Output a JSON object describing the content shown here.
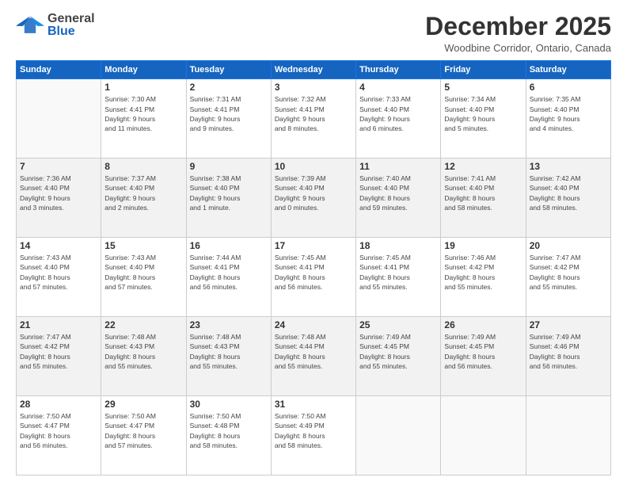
{
  "header": {
    "logo_general": "General",
    "logo_blue": "Blue",
    "month_title": "December 2025",
    "location": "Woodbine Corridor, Ontario, Canada"
  },
  "days_of_week": [
    "Sunday",
    "Monday",
    "Tuesday",
    "Wednesday",
    "Thursday",
    "Friday",
    "Saturday"
  ],
  "weeks": [
    [
      {
        "day": "",
        "info": ""
      },
      {
        "day": "1",
        "info": "Sunrise: 7:30 AM\nSunset: 4:41 PM\nDaylight: 9 hours\nand 11 minutes."
      },
      {
        "day": "2",
        "info": "Sunrise: 7:31 AM\nSunset: 4:41 PM\nDaylight: 9 hours\nand 9 minutes."
      },
      {
        "day": "3",
        "info": "Sunrise: 7:32 AM\nSunset: 4:41 PM\nDaylight: 9 hours\nand 8 minutes."
      },
      {
        "day": "4",
        "info": "Sunrise: 7:33 AM\nSunset: 4:40 PM\nDaylight: 9 hours\nand 6 minutes."
      },
      {
        "day": "5",
        "info": "Sunrise: 7:34 AM\nSunset: 4:40 PM\nDaylight: 9 hours\nand 5 minutes."
      },
      {
        "day": "6",
        "info": "Sunrise: 7:35 AM\nSunset: 4:40 PM\nDaylight: 9 hours\nand 4 minutes."
      }
    ],
    [
      {
        "day": "7",
        "info": "Sunrise: 7:36 AM\nSunset: 4:40 PM\nDaylight: 9 hours\nand 3 minutes."
      },
      {
        "day": "8",
        "info": "Sunrise: 7:37 AM\nSunset: 4:40 PM\nDaylight: 9 hours\nand 2 minutes."
      },
      {
        "day": "9",
        "info": "Sunrise: 7:38 AM\nSunset: 4:40 PM\nDaylight: 9 hours\nand 1 minute."
      },
      {
        "day": "10",
        "info": "Sunrise: 7:39 AM\nSunset: 4:40 PM\nDaylight: 9 hours\nand 0 minutes."
      },
      {
        "day": "11",
        "info": "Sunrise: 7:40 AM\nSunset: 4:40 PM\nDaylight: 8 hours\nand 59 minutes."
      },
      {
        "day": "12",
        "info": "Sunrise: 7:41 AM\nSunset: 4:40 PM\nDaylight: 8 hours\nand 58 minutes."
      },
      {
        "day": "13",
        "info": "Sunrise: 7:42 AM\nSunset: 4:40 PM\nDaylight: 8 hours\nand 58 minutes."
      }
    ],
    [
      {
        "day": "14",
        "info": "Sunrise: 7:43 AM\nSunset: 4:40 PM\nDaylight: 8 hours\nand 57 minutes."
      },
      {
        "day": "15",
        "info": "Sunrise: 7:43 AM\nSunset: 4:40 PM\nDaylight: 8 hours\nand 57 minutes."
      },
      {
        "day": "16",
        "info": "Sunrise: 7:44 AM\nSunset: 4:41 PM\nDaylight: 8 hours\nand 56 minutes."
      },
      {
        "day": "17",
        "info": "Sunrise: 7:45 AM\nSunset: 4:41 PM\nDaylight: 8 hours\nand 56 minutes."
      },
      {
        "day": "18",
        "info": "Sunrise: 7:45 AM\nSunset: 4:41 PM\nDaylight: 8 hours\nand 55 minutes."
      },
      {
        "day": "19",
        "info": "Sunrise: 7:46 AM\nSunset: 4:42 PM\nDaylight: 8 hours\nand 55 minutes."
      },
      {
        "day": "20",
        "info": "Sunrise: 7:47 AM\nSunset: 4:42 PM\nDaylight: 8 hours\nand 55 minutes."
      }
    ],
    [
      {
        "day": "21",
        "info": "Sunrise: 7:47 AM\nSunset: 4:42 PM\nDaylight: 8 hours\nand 55 minutes."
      },
      {
        "day": "22",
        "info": "Sunrise: 7:48 AM\nSunset: 4:43 PM\nDaylight: 8 hours\nand 55 minutes."
      },
      {
        "day": "23",
        "info": "Sunrise: 7:48 AM\nSunset: 4:43 PM\nDaylight: 8 hours\nand 55 minutes."
      },
      {
        "day": "24",
        "info": "Sunrise: 7:48 AM\nSunset: 4:44 PM\nDaylight: 8 hours\nand 55 minutes."
      },
      {
        "day": "25",
        "info": "Sunrise: 7:49 AM\nSunset: 4:45 PM\nDaylight: 8 hours\nand 55 minutes."
      },
      {
        "day": "26",
        "info": "Sunrise: 7:49 AM\nSunset: 4:45 PM\nDaylight: 8 hours\nand 56 minutes."
      },
      {
        "day": "27",
        "info": "Sunrise: 7:49 AM\nSunset: 4:46 PM\nDaylight: 8 hours\nand 56 minutes."
      }
    ],
    [
      {
        "day": "28",
        "info": "Sunrise: 7:50 AM\nSunset: 4:47 PM\nDaylight: 8 hours\nand 56 minutes."
      },
      {
        "day": "29",
        "info": "Sunrise: 7:50 AM\nSunset: 4:47 PM\nDaylight: 8 hours\nand 57 minutes."
      },
      {
        "day": "30",
        "info": "Sunrise: 7:50 AM\nSunset: 4:48 PM\nDaylight: 8 hours\nand 58 minutes."
      },
      {
        "day": "31",
        "info": "Sunrise: 7:50 AM\nSunset: 4:49 PM\nDaylight: 8 hours\nand 58 minutes."
      },
      {
        "day": "",
        "info": ""
      },
      {
        "day": "",
        "info": ""
      },
      {
        "day": "",
        "info": ""
      }
    ]
  ],
  "row_shading": [
    false,
    true,
    false,
    true,
    false
  ]
}
